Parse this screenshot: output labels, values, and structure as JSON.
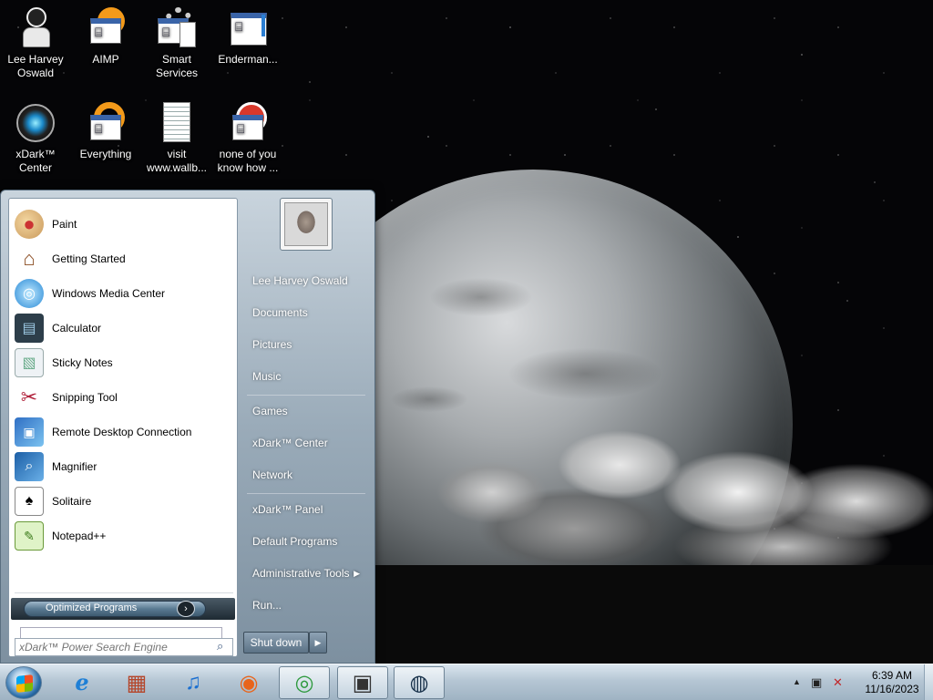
{
  "desktop_icons": [
    {
      "id": "lee-harvey-oswald",
      "label": "Lee Harvey Oswald",
      "icon": "user-figure-icon"
    },
    {
      "id": "aimp",
      "label": "AIMP",
      "icon": "aimp-icon"
    },
    {
      "id": "smart-services",
      "label": "Smart Services",
      "icon": "gear-document-icon"
    },
    {
      "id": "enderman",
      "label": "Enderman...",
      "icon": "window-icon"
    },
    {
      "id": "xdark-center",
      "label": "xDark™ Center",
      "icon": "xdark-orb-icon"
    },
    {
      "id": "everything",
      "label": "Everything",
      "icon": "everything-icon"
    },
    {
      "id": "visit-wallb",
      "label": "visit www.wallb...",
      "icon": "text-document-icon"
    },
    {
      "id": "none-of-you",
      "label": "none of you know how ...",
      "icon": "window-icon"
    }
  ],
  "start_menu": {
    "programs": [
      {
        "label": "Paint",
        "icon": "paint-palette-icon"
      },
      {
        "label": "Getting Started",
        "icon": "getting-started-icon"
      },
      {
        "label": "Windows Media Center",
        "icon": "media-center-icon"
      },
      {
        "label": "Calculator",
        "icon": "calculator-icon"
      },
      {
        "label": "Sticky Notes",
        "icon": "sticky-notes-icon"
      },
      {
        "label": "Snipping Tool",
        "icon": "snipping-tool-icon"
      },
      {
        "label": "Remote Desktop Connection",
        "icon": "remote-desktop-icon"
      },
      {
        "label": "Magnifier",
        "icon": "magnifier-icon"
      },
      {
        "label": "Solitaire",
        "icon": "playing-card-icon"
      },
      {
        "label": "Notepad++",
        "icon": "notepad-plus-icon"
      }
    ],
    "all_programs_label": "Optimized Programs",
    "search_placeholder": "xDark™ Power Search Engine",
    "right_items": [
      {
        "label": "Lee Harvey Oswald"
      },
      {
        "label": "Documents"
      },
      {
        "label": "Pictures"
      },
      {
        "label": "Music"
      },
      {
        "label": "Games"
      },
      {
        "label": "xDark™ Center"
      },
      {
        "label": "Network"
      },
      {
        "label": "xDark™ Panel"
      },
      {
        "label": "Default Programs"
      },
      {
        "label": "Administrative Tools",
        "submenu": true
      },
      {
        "label": "Run..."
      }
    ],
    "shutdown_label": "Shut down"
  },
  "taskbar": {
    "pinned": [
      {
        "name": "internet-explorer",
        "icon": "internet-explorer-icon",
        "glyph": "ℯ",
        "color": "#1e7fd6"
      },
      {
        "name": "store",
        "icon": "store-icon",
        "glyph": "▦",
        "color": "#b5462b"
      },
      {
        "name": "music",
        "icon": "music-note-icon",
        "glyph": "♫",
        "color": "#1a6fd1"
      },
      {
        "name": "firefox",
        "icon": "firefox-icon",
        "glyph": "◉",
        "color": "#e8641b"
      },
      {
        "name": "chrome",
        "icon": "chrome-icon",
        "glyph": "◎",
        "color": "#2f9a3f"
      },
      {
        "name": "media-player",
        "icon": "media-player-icon",
        "glyph": "▣",
        "color": "#333"
      },
      {
        "name": "steam",
        "icon": "steam-icon",
        "glyph": "◍",
        "color": "#173049"
      }
    ],
    "clock_time": "6:39 AM",
    "clock_date": "11/16/2023"
  }
}
